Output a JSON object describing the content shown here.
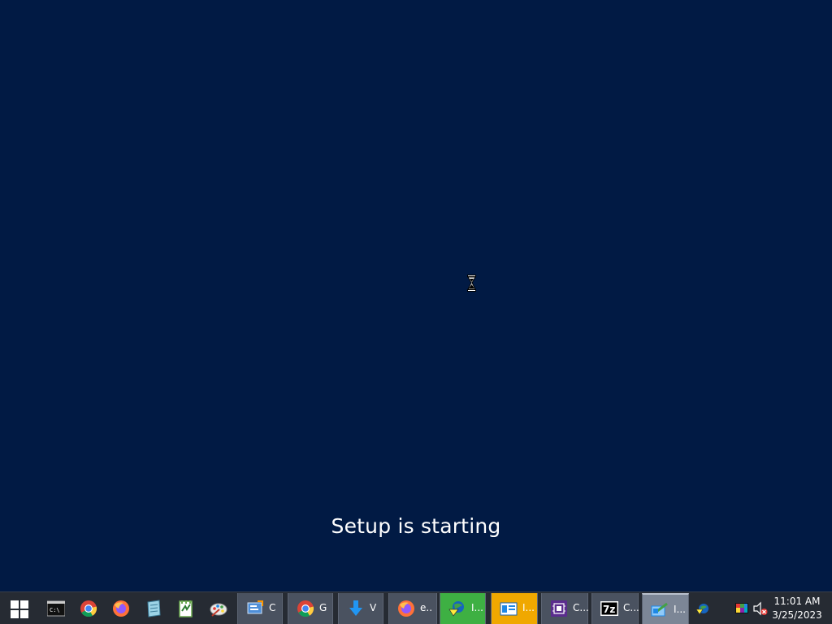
{
  "screen": {
    "status_text": "Setup is starting"
  },
  "taskbar": {
    "start_icon": "windows-logo-icon",
    "pinned": [
      {
        "name": "terminal",
        "icon": "command-prompt-icon"
      },
      {
        "name": "chrome",
        "icon": "chrome-icon"
      },
      {
        "name": "firefox",
        "icon": "firefox-icon"
      },
      {
        "name": "notepad",
        "icon": "notepad-icon"
      },
      {
        "name": "notepad-plus-plus",
        "icon": "notepad-plus-plus-icon"
      },
      {
        "name": "paint",
        "icon": "paint-palette-icon"
      }
    ],
    "apps": [
      {
        "label": "C",
        "icon": "control-panel-icon"
      },
      {
        "label": "G",
        "icon": "chrome-icon"
      },
      {
        "label": "V",
        "icon": "download-arrow-icon"
      },
      {
        "label": "e..",
        "icon": "firefox-icon"
      },
      {
        "label": "I...",
        "icon": "globe-download-icon"
      },
      {
        "label": "I...",
        "icon": "file-explorer-icon"
      },
      {
        "label": "C...",
        "icon": "cpu-z-icon"
      },
      {
        "label": "C...",
        "icon": "7zip-icon"
      },
      {
        "label": "I...",
        "icon": "installer-icon"
      }
    ],
    "tray": {
      "icons": [
        "network-globe-icon",
        "color-display-icon",
        "volume-muted-icon"
      ],
      "time": "11:01 AM",
      "date": "3/25/2023"
    }
  },
  "colors": {
    "desktop_background": "#011a44",
    "taskbar_background": "#262b33",
    "active_green": "#3eb043",
    "active_orange": "#f0a800"
  }
}
